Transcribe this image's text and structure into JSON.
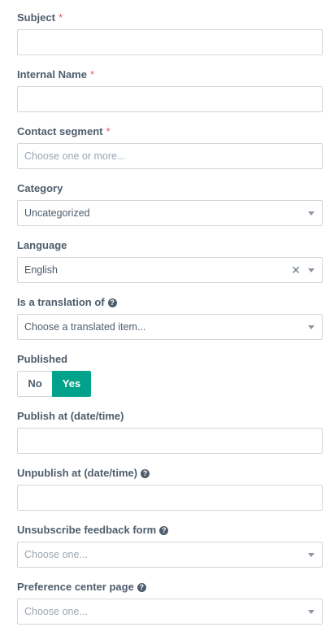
{
  "form": {
    "subject": {
      "label": "Subject",
      "required": "*",
      "value": ""
    },
    "internal_name": {
      "label": "Internal Name",
      "required": "*",
      "value": ""
    },
    "contact_segment": {
      "label": "Contact segment",
      "required": "*",
      "placeholder": "Choose one or more..."
    },
    "category": {
      "label": "Category",
      "value": "Uncategorized"
    },
    "language": {
      "label": "Language",
      "value": "English",
      "clear": "✕"
    },
    "translation_of": {
      "label": "Is a translation of",
      "placeholder": "Choose a translated item..."
    },
    "published": {
      "label": "Published",
      "no": "No",
      "yes": "Yes",
      "selected": "Yes"
    },
    "publish_at": {
      "label": "Publish at (date/time)",
      "value": ""
    },
    "unpublish_at": {
      "label": "Unpublish at (date/time)",
      "value": ""
    },
    "unsubscribe_form": {
      "label": "Unsubscribe feedback form",
      "placeholder": "Choose one..."
    },
    "preference_page": {
      "label": "Preference center page",
      "placeholder": "Choose one..."
    }
  },
  "icons": {
    "help": "question-circle-icon",
    "caret": "chevron-down-icon",
    "clear": "close-icon"
  },
  "colors": {
    "accent": "#00a38a",
    "required": "#e6575e",
    "text": "#4e5d6c",
    "border": "#cfd6dd"
  }
}
